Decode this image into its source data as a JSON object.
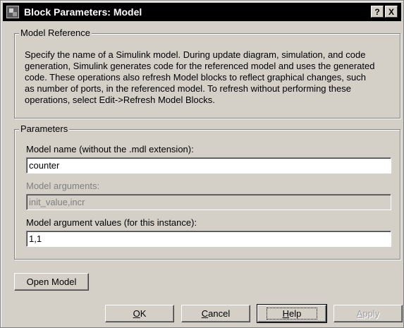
{
  "window": {
    "title": "Block Parameters: Model",
    "help_button": "?",
    "close_button": "X"
  },
  "model_reference": {
    "legend": "Model Reference",
    "description": "Specify the name of a Simulink model. During update diagram, simulation, and code\ngeneration, Simulink generates code for the referenced model and uses the generated\ncode.  These operations also refresh Model blocks to reflect graphical changes, such\nas number of ports, in the referenced model. To refresh without performing these\noperations, select Edit->Refresh Model Blocks."
  },
  "parameters": {
    "legend": "Parameters",
    "model_name_label": "Model name (without the .mdl extension):",
    "model_name_value": "counter",
    "model_args_label": "Model arguments:",
    "model_args_value": "init_value,incr",
    "model_arg_values_label": "Model argument values (for this instance):",
    "model_arg_values_value": "1,1"
  },
  "buttons": {
    "open_model": "Open Model",
    "ok_mnemonic": "O",
    "ok_rest": "K",
    "cancel_mnemonic": "C",
    "cancel_rest": "ancel",
    "help_mnemonic": "H",
    "help_rest": "elp",
    "apply_mnemonic": "A",
    "apply_rest": "pply"
  }
}
